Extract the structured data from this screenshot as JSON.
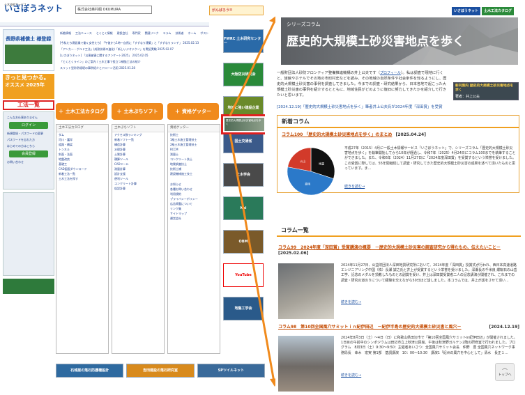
{
  "left": {
    "logo_sub": "土木技術サービス",
    "logo": "いさぼうネット",
    "sponsor": "株式会社奥村組 OKUMURA",
    "top_right_banner": "がんばろう!!",
    "nav": [
      "新着情報",
      "工法ニュース",
      "とくとく情報",
      "建設会社",
      "専門家",
      "関連リンク",
      "コラム",
      "技術者",
      "ホーム",
      "ポスト"
    ],
    "news": [
      "[今私たち建設業で働く女性たち] 「午後から1時～自然に「すずなり建築」と「すずなりランチ」 2025.02.13",
      "「アンカー・ゲルド工法」(成熟技術の進化)「新しいジオテクノ」を実証実験 2025.02.07",
      "[いさぼうネット] 「災害被害に関するアンケート2025」 2025.02.05",
      "「とくとくライン」のご案内 / 土木工事で役立つ補強工法の紹介",
      "スリット型砂防堰堤の事例紹介とドローン活用 2025.01.28"
    ],
    "welcome_title": "長野県補償土 様登録",
    "summer_title": "きっと見つかる。",
    "summer_year": "オススメ 2025年",
    "side_title": "工法一覧",
    "side_links": [
      "こんなお仕事ありません",
      "ログイン",
      "新規登録・パスワードの変更",
      "パスワードを忘れた方",
      "はじめての方はこちら",
      "会員登録",
      "お問い合わせ"
    ],
    "btn_catalog": "土木工法カタログ",
    "btn_soft": "土木ぷちソフト",
    "btn_getter": "資格ゲッター",
    "col1_head": "土木工法カタログ",
    "col1_links": [
      "ダム",
      "河川・護岸",
      "道路・橋梁",
      "トンネル",
      "斜面・法面",
      "地盤改良",
      "基礎工",
      "CAD図面ダウンロード",
      "新着工法一覧",
      "土木工法を探す"
    ],
    "col2_head": "土木ぷちソフト",
    "col2_links": [
      "アクセス数ランキング",
      "新着ソフト一覧",
      "構造計算",
      "水理計算",
      "土質計算",
      "積算ツール",
      "CADツール",
      "測量計算",
      "設計支援",
      "便利ツール",
      "コンクリート計算",
      "仮設計算"
    ],
    "col3_head": "資格ゲッター",
    "col3_links": [
      "技術士",
      "1級土木施工管理技士",
      "2級土木施工管理技士",
      "RCCM",
      "測量士",
      "コンクリート技士",
      "地質調査技士",
      "技術士補",
      "建設機械施工技士"
    ],
    "col_bottom": [
      "お知らせ",
      "各種お問い合わせ",
      "利用規約",
      "プライバシーポリシー",
      "広告掲載について",
      "リンク集",
      "サイトマップ",
      "運営会社"
    ],
    "bottom_ads": [
      "石城屋の落石防護柵設計",
      "吉田建設の落石研究室",
      "SPツイルネット"
    ],
    "right_ads": [
      "FWRC 土木研究センター",
      "大阪防災研究会",
      "地域に強い建設企業",
      "国土交通省",
      "土木学会",
      "Kai",
      "OBM",
      "YouTube",
      "地盤工学会"
    ],
    "highlight_thumb": "歴史的大規模土砂災害地点を歩く"
  },
  "right": {
    "top_logos": [
      "いさぼうネット",
      "土木工法カタログ"
    ],
    "series_label": "シリーズコラム",
    "title": "歴史的大規模土砂災害地点を歩く",
    "intro_a": "一般財団法人砂防フロンティア整備推進機構の井上公夫です（",
    "intro_link": "プロフィール",
    "intro_b": "）。私は調査で現地に行くと、旅館やホテルでその地の市町村史などを読み、その地域の自然条件や社会条件を知るようにし、歴史的大規模土砂災害の事例を調査してきました。今までの調査・研究結果から、日本各地で起こった大規模土砂災害の事例を紹介するとともに、地域住民がどのように復旧に努力してきたかを紹介して行きたいと思います。",
    "book_title": "新刊案内 歴史的大規模土砂災害地点を歩く",
    "book_author": "著者：井上公夫",
    "award": "[2024.12.19]「歴史的大規模土砂災害地点を歩く」筆者井上公夫氏が2024年度「深田賞」を受賞",
    "new_col_head": "新着コラム",
    "new_col_title": "コラム100 「歴史的大規模土砂災害地点を歩く」のまとめ",
    "new_col_date": "[2025.04.24]",
    "new_col_body": "平成27年（2015）4月に一般土木情報サービス「いさぼうネット」で、シリーズコラム「歴史的大規模土砂災害地点を歩く」を執筆開始してから10年が経過し、令和7年（2025）4月24日にコラム100までを執筆することができました。また、令和6年（2024）11月27日に「2024年度深田賞」を受賞するという栄誉を受けました。この受賞に際しては、55年間継続して調査・研究してきた歴史的大規模土砂災害の成果を述べて頂いたものと思っています。ま…",
    "read_more": "続きを読む→",
    "list_head": "コラム一覧",
    "c99_title": "コラム99　2024年度「深田賞」受賞講演の概要　－歴史的大規模土砂災害の調査研究から得たもの、伝えたいこと－",
    "c99_date": "[2025.02.06]",
    "c99_body": "2024年11月27日、公益財団法人深田地質研究所において、2024年度「深田賞」授賞式が行われ、西日本高速道路エンジニアリング中国（株）長瀬 誠之氏と井上が受賞するという栄誉を受けました。深瀬長の千米良 爆転石の山岳工学、記念のメダルを頂戴したものとの副賞を受け、井上は深田賞受賞者二人の記念講演が開催され、これまでの調査・研究の道のりについて経験を交えながら50分ほど話しました。本コラムでは、井上が話をさせて頂い…",
    "c98_title": "コラム98　第10回全国風穴サミットｉｎ紀伊田辺　－紀伊半島の歴史的大規模土砂災害と風穴－",
    "c98_date": "[2024.12.19]",
    "c98_body": "2024年8月3日（土）～4日（日）に和歌山県田辺市で「第10回全国風穴サミットin紀伊田辺」が開催されました。1日目の午前中のシンポジウムは田辺市立上秋津公民館、午後は秋津野ガルテン2階の研修室で行われました。プログラム　8月3日（土）9:30～9:50：主催者あいさつ：全国風穴サミット会長　仲野　豊 全国風穴ネットワーク事務局長　幸木　宏実 第1部　基調講演　10：00～10:30　講演1「紀州の風穴を中心として」清水　長正１…",
    "pie_labels": [
      "地震",
      "豪雨",
      "火山"
    ],
    "pie_values": [
      30,
      48,
      22
    ],
    "pie_colors": [
      "#111111",
      "#2b79c9",
      "#d23a2a"
    ],
    "to_top": "トップへ"
  },
  "colors": {
    "orange": "#f08a1c",
    "red": "#e02020",
    "link": "#1a4fa0",
    "brand": "#1a4fa0"
  }
}
